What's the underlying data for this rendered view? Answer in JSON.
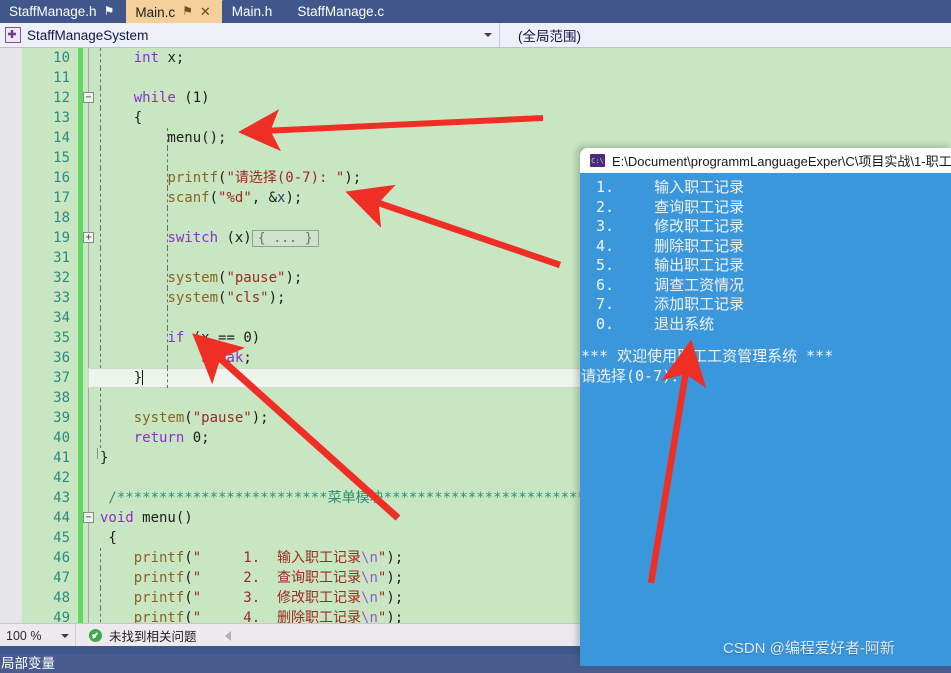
{
  "window": {
    "app": "Visual Studio",
    "accent_blue": "#41578c",
    "editor_background": "#c9e6c2",
    "console_background": "#3b97dc"
  },
  "tabs": [
    {
      "label": "StaffManage.h",
      "pin": "⚑",
      "close": "",
      "active": false
    },
    {
      "label": "Main.c",
      "pin": "⚑",
      "close": "✕",
      "active": true
    },
    {
      "label": "Main.h",
      "pin": "",
      "close": "",
      "active": false
    },
    {
      "label": "StaffManage.c",
      "pin": "",
      "close": "",
      "active": false
    }
  ],
  "navbar": {
    "scope_project": "StaffManageSystem",
    "scope_member": "(全局范围)"
  },
  "editor": {
    "lines": [
      {
        "num": "10",
        "fold": "",
        "indent_guides": [
          1
        ],
        "tokens": [
          {
            "t": "    ",
            "c": "plain"
          },
          {
            "t": "int",
            "c": "kw"
          },
          {
            "t": " x;",
            "c": "plain"
          }
        ]
      },
      {
        "num": "11",
        "fold": "",
        "indent_guides": [
          1
        ],
        "tokens": []
      },
      {
        "num": "12",
        "fold": "−",
        "indent_guides": [
          1
        ],
        "tokens": [
          {
            "t": "    ",
            "c": "plain"
          },
          {
            "t": "while",
            "c": "kw"
          },
          {
            "t": " (1)",
            "c": "plain"
          }
        ]
      },
      {
        "num": "13",
        "fold": "",
        "indent_guides": [
          1
        ],
        "tokens": [
          {
            "t": "    {",
            "c": "plain"
          }
        ]
      },
      {
        "num": "14",
        "fold": "",
        "indent_guides": [
          1,
          2
        ],
        "tokens": [
          {
            "t": "        menu();",
            "c": "plain"
          }
        ]
      },
      {
        "num": "15",
        "fold": "",
        "indent_guides": [
          1,
          2
        ],
        "tokens": []
      },
      {
        "num": "16",
        "fold": "",
        "indent_guides": [
          1,
          2
        ],
        "tokens": [
          {
            "t": "        ",
            "c": "plain"
          },
          {
            "t": "printf",
            "c": "fn"
          },
          {
            "t": "(",
            "c": "plain"
          },
          {
            "t": "\"请选择(0-7): \"",
            "c": "str"
          },
          {
            "t": ");",
            "c": "plain"
          }
        ]
      },
      {
        "num": "17",
        "fold": "",
        "indent_guides": [
          1,
          2
        ],
        "tokens": [
          {
            "t": "        ",
            "c": "plain"
          },
          {
            "t": "scanf",
            "c": "fn"
          },
          {
            "t": "(",
            "c": "plain"
          },
          {
            "t": "\"%d\"",
            "c": "str"
          },
          {
            "t": ", &",
            "c": "plain"
          },
          {
            "t": "x",
            "c": "var"
          },
          {
            "t": ");",
            "c": "plain"
          }
        ]
      },
      {
        "num": "18",
        "fold": "",
        "indent_guides": [
          1,
          2
        ],
        "tokens": []
      },
      {
        "num": "19",
        "fold": "+",
        "indent_guides": [
          1,
          2
        ],
        "collapsed": "{ ... }",
        "tokens": [
          {
            "t": "        ",
            "c": "plain"
          },
          {
            "t": "switch",
            "c": "kw"
          },
          {
            "t": " (x)",
            "c": "plain"
          }
        ]
      },
      {
        "num": "31",
        "fold": "",
        "indent_guides": [
          1,
          2
        ],
        "tokens": []
      },
      {
        "num": "32",
        "fold": "",
        "indent_guides": [
          1,
          2
        ],
        "tokens": [
          {
            "t": "        ",
            "c": "plain"
          },
          {
            "t": "system",
            "c": "fn"
          },
          {
            "t": "(",
            "c": "plain"
          },
          {
            "t": "\"pause\"",
            "c": "str"
          },
          {
            "t": ");",
            "c": "plain"
          }
        ]
      },
      {
        "num": "33",
        "fold": "",
        "indent_guides": [
          1,
          2
        ],
        "tokens": [
          {
            "t": "        ",
            "c": "plain"
          },
          {
            "t": "system",
            "c": "fn"
          },
          {
            "t": "(",
            "c": "plain"
          },
          {
            "t": "\"cls\"",
            "c": "str"
          },
          {
            "t": ");",
            "c": "plain"
          }
        ]
      },
      {
        "num": "34",
        "fold": "",
        "indent_guides": [
          1,
          2
        ],
        "tokens": []
      },
      {
        "num": "35",
        "fold": "",
        "indent_guides": [
          1,
          2
        ],
        "tokens": [
          {
            "t": "        ",
            "c": "plain"
          },
          {
            "t": "if",
            "c": "kw"
          },
          {
            "t": " (x == ",
            "c": "plain"
          },
          {
            "t": "0",
            "c": "num"
          },
          {
            "t": ")",
            "c": "plain"
          }
        ]
      },
      {
        "num": "36",
        "fold": "",
        "indent_guides": [
          1,
          2
        ],
        "tokens": [
          {
            "t": "            ",
            "c": "plain"
          },
          {
            "t": "break",
            "c": "kw"
          },
          {
            "t": ";",
            "c": "plain"
          }
        ]
      },
      {
        "num": "37",
        "fold": "",
        "indent_guides": [
          2
        ],
        "current": true,
        "caret": true,
        "tokens": [
          {
            "t": "    }",
            "c": "plain"
          }
        ]
      },
      {
        "num": "38",
        "fold": "",
        "indent_guides": [
          1
        ],
        "tokens": []
      },
      {
        "num": "39",
        "fold": "",
        "indent_guides": [
          1
        ],
        "tokens": [
          {
            "t": "    ",
            "c": "plain"
          },
          {
            "t": "system",
            "c": "fn"
          },
          {
            "t": "(",
            "c": "plain"
          },
          {
            "t": "\"pause\"",
            "c": "str"
          },
          {
            "t": ");",
            "c": "plain"
          }
        ]
      },
      {
        "num": "40",
        "fold": "",
        "indent_guides": [
          1
        ],
        "tokens": [
          {
            "t": "    ",
            "c": "plain"
          },
          {
            "t": "return",
            "c": "kw"
          },
          {
            "t": " ",
            "c": "plain"
          },
          {
            "t": "0",
            "c": "num"
          },
          {
            "t": ";",
            "c": "plain"
          }
        ]
      },
      {
        "num": "41",
        "fold": "",
        "indent_guides": [],
        "brace_end": true,
        "tokens": [
          {
            "t": "}",
            "c": "plain"
          }
        ]
      },
      {
        "num": "42",
        "fold": "",
        "indent_guides": [],
        "tokens": []
      },
      {
        "num": "43",
        "fold": "",
        "indent_guides": [],
        "tokens": [
          {
            "t": " /*************************菜单模块*************************",
            "c": "cmt"
          }
        ]
      },
      {
        "num": "44",
        "fold": "−",
        "indent_guides": [],
        "tokens": [
          {
            "t": "",
            "c": "plain"
          },
          {
            "t": "void",
            "c": "kw"
          },
          {
            "t": " menu()",
            "c": "plain"
          }
        ]
      },
      {
        "num": "45",
        "fold": "",
        "indent_guides": [],
        "tokens": [
          {
            "t": " {",
            "c": "plain"
          }
        ]
      },
      {
        "num": "46",
        "fold": "",
        "indent_guides": [
          1
        ],
        "tokens": [
          {
            "t": "    ",
            "c": "plain"
          },
          {
            "t": "printf",
            "c": "fn"
          },
          {
            "t": "(",
            "c": "plain"
          },
          {
            "t": "\"     1.  输入职工记录",
            "c": "str"
          },
          {
            "t": "\\n",
            "c": "esc"
          },
          {
            "t": "\"",
            "c": "str"
          },
          {
            "t": ");",
            "c": "plain"
          }
        ]
      },
      {
        "num": "47",
        "fold": "",
        "indent_guides": [
          1
        ],
        "tokens": [
          {
            "t": "    ",
            "c": "plain"
          },
          {
            "t": "printf",
            "c": "fn"
          },
          {
            "t": "(",
            "c": "plain"
          },
          {
            "t": "\"     2.  查询职工记录",
            "c": "str"
          },
          {
            "t": "\\n",
            "c": "esc"
          },
          {
            "t": "\"",
            "c": "str"
          },
          {
            "t": ");",
            "c": "plain"
          }
        ]
      },
      {
        "num": "48",
        "fold": "",
        "indent_guides": [
          1
        ],
        "tokens": [
          {
            "t": "    ",
            "c": "plain"
          },
          {
            "t": "printf",
            "c": "fn"
          },
          {
            "t": "(",
            "c": "plain"
          },
          {
            "t": "\"     3.  修改职工记录",
            "c": "str"
          },
          {
            "t": "\\n",
            "c": "esc"
          },
          {
            "t": "\"",
            "c": "str"
          },
          {
            "t": ");",
            "c": "plain"
          }
        ]
      },
      {
        "num": "49",
        "fold": "",
        "indent_guides": [
          1
        ],
        "tokens": [
          {
            "t": "    ",
            "c": "plain"
          },
          {
            "t": "printf",
            "c": "fn"
          },
          {
            "t": "(",
            "c": "plain"
          },
          {
            "t": "\"     4.  删除职工记录",
            "c": "str"
          },
          {
            "t": "\\n",
            "c": "esc"
          },
          {
            "t": "\"",
            "c": "str"
          },
          {
            "t": ");",
            "c": "plain"
          }
        ]
      }
    ]
  },
  "zoombar": {
    "zoom_level": "100 %",
    "error_status": "未找到相关问题"
  },
  "statusbar": {
    "text": "局部变量"
  },
  "console": {
    "title": "E:\\Document\\programmLanguageExper\\C\\项目实战\\1-职工",
    "menu": [
      {
        "num": "1.",
        "label": "输入职工记录"
      },
      {
        "num": "2.",
        "label": "查询职工记录"
      },
      {
        "num": "3.",
        "label": "修改职工记录"
      },
      {
        "num": "4.",
        "label": "删除职工记录"
      },
      {
        "num": "5.",
        "label": "输出职工记录"
      },
      {
        "num": "6.",
        "label": "调查工资情况"
      },
      {
        "num": "7.",
        "label": "添加职工记录"
      },
      {
        "num": "0.",
        "label": "退出系统"
      }
    ],
    "welcome": "*** 欢迎使用职工工资管理系统 ***",
    "prompt": "请选择(0-7)："
  },
  "annotations": {
    "arrow_color": "#ef2f26",
    "arrows": [
      {
        "name": "arrow-to-menu-call"
      },
      {
        "name": "arrow-to-scanf-line"
      },
      {
        "name": "arrow-to-menu-comment"
      },
      {
        "name": "arrow-to-console-prompt"
      }
    ]
  },
  "watermark": {
    "text": "CSDN @编程爱好者-阿新"
  }
}
